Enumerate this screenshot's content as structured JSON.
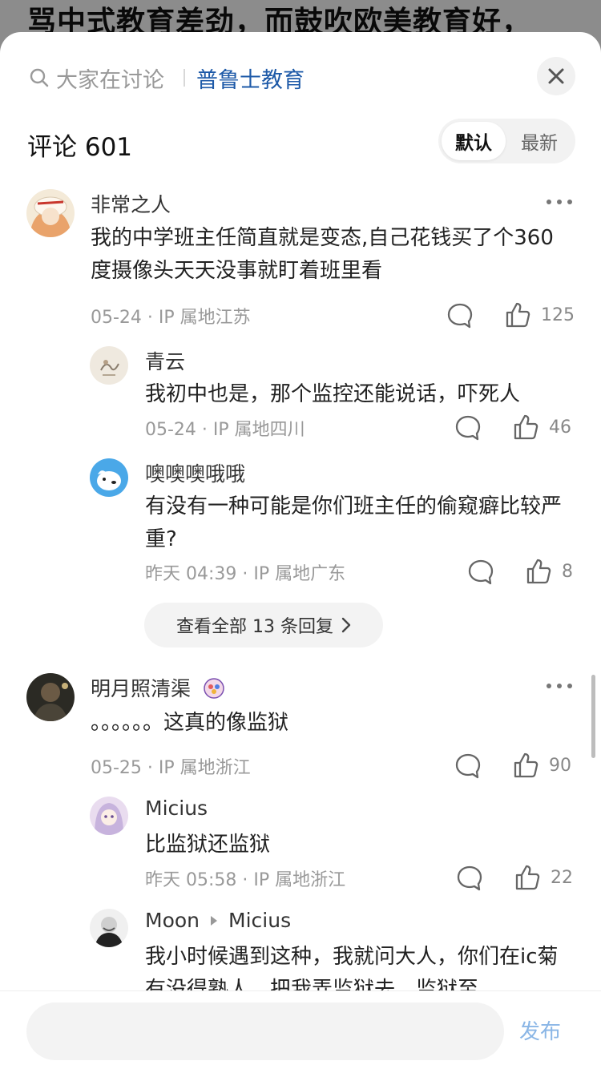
{
  "background": {
    "article_text": "骂中式教育差劲，而鼓吹欧美教育好，"
  },
  "search": {
    "label": "大家在讨论",
    "topic": "普鲁士教育"
  },
  "header": {
    "comments_title": "评论 601",
    "sort_default": "默认",
    "sort_latest": "最新"
  },
  "comments": [
    {
      "user": "非常之人",
      "text": "我的中学班主任简直就是变态,自己花钱买了个360度摄像头天天没事就盯着班里看",
      "meta": "05-24 · IP 属地江苏",
      "likes": "125",
      "replies": [
        {
          "user": "青云",
          "text": "我初中也是，那个监控还能说话，吓死人",
          "meta": "05-24 · IP 属地四川",
          "likes": "46"
        },
        {
          "user": "噢噢噢哦哦",
          "text": "有没有一种可能是你们班主任的偷窥癖比较严重?",
          "meta": "昨天 04:39 · IP 属地广东",
          "likes": "8"
        }
      ],
      "view_all": "查看全部 13 条回复"
    },
    {
      "user": "明月照清渠",
      "text": "。。。。。。这真的像监狱",
      "meta": "05-25 · IP 属地浙江",
      "likes": "90",
      "replies": [
        {
          "user": "Micius",
          "text": "比监狱还监狱",
          "meta": "昨天 05:58 · IP 属地浙江",
          "likes": "22"
        },
        {
          "user": "Moon",
          "reply_to": "Micius",
          "text": "我小时候遇到这种，我就问大人，你们在ic菊有没得熟人，把我弄监狱去，监狱至"
        }
      ]
    }
  ],
  "input": {
    "placeholder": "",
    "publish_label": "发布"
  },
  "colors": {
    "topic_blue": "#1e5aa8",
    "publish_blue": "#8ab6e6"
  }
}
